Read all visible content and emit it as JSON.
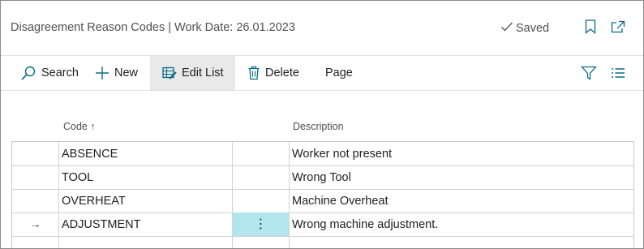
{
  "header": {
    "title": "Disagreement Reason Codes | Work Date: 26.01.2023",
    "saved_label": "Saved",
    "icons": [
      "check-icon",
      "bookmark-icon",
      "open-in-new-icon"
    ]
  },
  "actions": {
    "search": "Search",
    "new": "New",
    "edit_list": "Edit List",
    "delete": "Delete",
    "page": "Page"
  },
  "columns": {
    "code": "Code",
    "code_sort": "↑",
    "description": "Description"
  },
  "rows": [
    {
      "code": "ABSENCE",
      "description": "Worker not present"
    },
    {
      "code": "TOOL",
      "description": "Wrong Tool"
    },
    {
      "code": "OVERHEAT",
      "description": "Machine Overheat"
    },
    {
      "code": "ADJUSTMENT",
      "description": "Wrong machine adjustment.",
      "indicator": "→",
      "menu": "⋮"
    }
  ],
  "colors": {
    "accent": "#0a6a86",
    "active_cell": "#b3e5ee",
    "active_action": "#e9e9e9"
  }
}
